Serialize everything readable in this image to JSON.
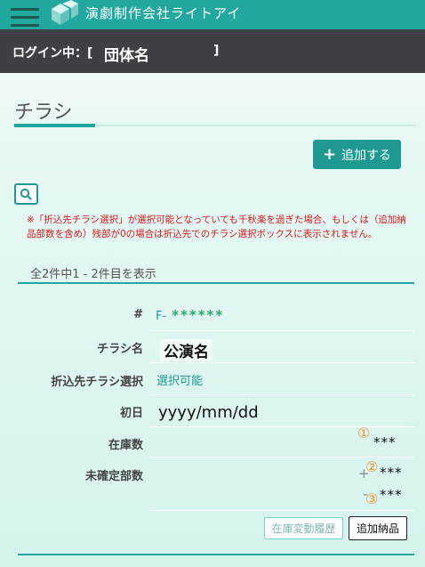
{
  "header": {
    "site_title": "演劇制作会社ライトアイ",
    "menu_icon": "hamburger-icon",
    "logo_icon": "stacked-boxes-logo",
    "brand_color": "#23a8a0"
  },
  "login": {
    "prefix": "ログイン中：[",
    "org_name": "団体名",
    "close_bracket": "]"
  },
  "page": {
    "title": "チラシ",
    "add_button": "追加する",
    "search_icon": "search-icon",
    "notice": "※「折込先チラシ選択」が選択可能となっていても千秋楽を過ぎた場合、もしくは（追加納品部数を含め）残部が0の場合は折込先でのチラシ選択ボックスに表示されません。",
    "count_text": "全2件中1 - 2件目を表示"
  },
  "record": {
    "labels": {
      "id": "#",
      "name": "チラシ名",
      "selection": "折込先チラシ選択",
      "first_day": "初日",
      "stock": "在庫数",
      "pending": "未確定部数"
    },
    "id_prefix": "F-",
    "id_value": "******",
    "name": "公演名",
    "selection": "選択可能",
    "first_day": "yyyy/mm/dd",
    "stock": "***",
    "pending_plus": "***",
    "pending_minus": "***",
    "plus_sign": "+",
    "minus_sign": "-",
    "marker1": "①",
    "marker2": "②",
    "marker3": "③",
    "history_button": "在庫変動履歴",
    "add_delivery_button": "追加納品"
  }
}
